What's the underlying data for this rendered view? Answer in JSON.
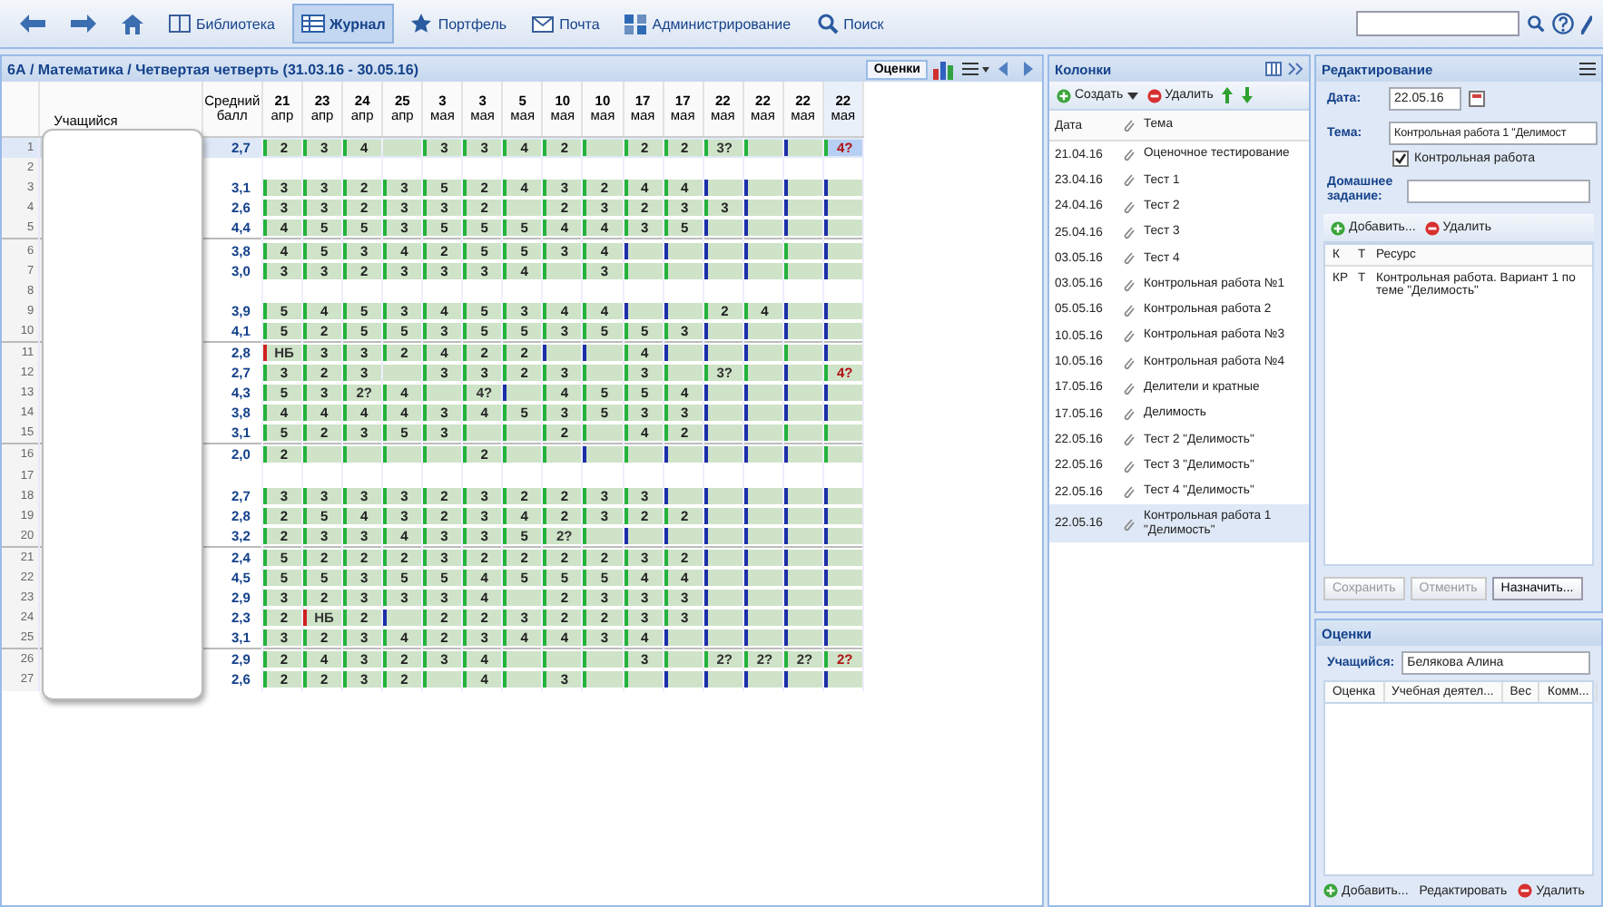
{
  "toolbar": {
    "items": [
      {
        "label": "Библиотека",
        "selected": false
      },
      {
        "label": "Журнал",
        "selected": true
      },
      {
        "label": "Портфель",
        "selected": false
      },
      {
        "label": "Почта",
        "selected": false
      },
      {
        "label": "Администрирование",
        "selected": false
      },
      {
        "label": "Поиск",
        "selected": false
      }
    ]
  },
  "journal": {
    "title": "6А / Математика / Четвертая четверть (31.03.16 - 30.05.16)",
    "tool_button": "Оценки",
    "student_heading": "Учащийся",
    "average_heading": "Средний балл",
    "columns": [
      {
        "day": "21",
        "month": "апр",
        "selected": false
      },
      {
        "day": "23",
        "month": "апр",
        "selected": false
      },
      {
        "day": "24",
        "month": "апр",
        "selected": false
      },
      {
        "day": "25",
        "month": "апр",
        "selected": false
      },
      {
        "day": "3",
        "month": "мая",
        "selected": false
      },
      {
        "day": "3",
        "month": "мая",
        "selected": false
      },
      {
        "day": "5",
        "month": "мая",
        "selected": false
      },
      {
        "day": "10",
        "month": "мая",
        "selected": false
      },
      {
        "day": "10",
        "month": "мая",
        "selected": false
      },
      {
        "day": "17",
        "month": "мая",
        "selected": false
      },
      {
        "day": "17",
        "month": "мая",
        "selected": false
      },
      {
        "day": "22",
        "month": "мая",
        "selected": false
      },
      {
        "day": "22",
        "month": "мая",
        "selected": false
      },
      {
        "day": "22",
        "month": "мая",
        "selected": false
      },
      {
        "day": "22",
        "month": "мая",
        "selected": true
      }
    ],
    "rows": [
      {
        "number": "1",
        "average": "2,7",
        "selected": true,
        "cells": [
          {
            "grade": "2",
            "color": "#22b33a"
          },
          {
            "grade": "3",
            "color": "#22b33a"
          },
          {
            "grade": "4",
            "color": "#22b33a"
          },
          null,
          {
            "grade": "3",
            "color": "#22b33a"
          },
          {
            "grade": "3",
            "color": "#22b33a"
          },
          {
            "grade": "4",
            "color": "#22b33a"
          },
          {
            "grade": "2",
            "color": "#22b33a"
          },
          {
            "color": "#22b33a"
          },
          {
            "grade": "2",
            "color": "#22b33a"
          },
          {
            "grade": "2",
            "color": "#22b33a"
          },
          {
            "grade": "3?",
            "color": "#22b33a"
          },
          {
            "color": "#22b33a"
          },
          {
            "color": "#1c2ea8"
          },
          {
            "grade": "4?",
            "color": "#22b33a"
          }
        ]
      },
      {
        "number": "2",
        "selected": false
      },
      {
        "number": "3",
        "average": "3,1",
        "selected": false,
        "cells": [
          {
            "grade": "3",
            "color": "#22b33a"
          },
          {
            "grade": "3",
            "color": "#22b33a"
          },
          {
            "grade": "2",
            "color": "#22b33a"
          },
          {
            "grade": "3",
            "color": "#22b33a"
          },
          {
            "grade": "5",
            "color": "#22b33a"
          },
          {
            "grade": "2",
            "color": "#22b33a"
          },
          {
            "grade": "4",
            "color": "#22b33a"
          },
          {
            "grade": "3",
            "color": "#22b33a"
          },
          {
            "grade": "2",
            "color": "#22b33a"
          },
          {
            "grade": "4",
            "color": "#22b33a"
          },
          {
            "grade": "4",
            "color": "#22b33a"
          },
          {
            "color": "#1c2ea8"
          },
          {
            "color": "#1c2ea8"
          },
          {
            "color": "#1c2ea8"
          },
          {
            "color": "#1c2ea8"
          }
        ]
      },
      {
        "number": "4",
        "average": "2,6",
        "selected": false,
        "cells": [
          {
            "grade": "3",
            "color": "#22b33a"
          },
          {
            "grade": "3",
            "color": "#22b33a"
          },
          {
            "grade": "2",
            "color": "#22b33a"
          },
          {
            "grade": "3",
            "color": "#22b33a"
          },
          {
            "grade": "3",
            "color": "#22b33a"
          },
          {
            "grade": "2",
            "color": "#22b33a"
          },
          {
            "color": "#22b33a"
          },
          {
            "grade": "2",
            "color": "#22b33a"
          },
          {
            "grade": "3",
            "color": "#22b33a"
          },
          {
            "grade": "2",
            "color": "#22b33a"
          },
          {
            "grade": "3",
            "color": "#22b33a"
          },
          {
            "grade": "3",
            "color": "#22b33a"
          },
          {
            "color": "#1c2ea8"
          },
          {
            "color": "#1c2ea8"
          },
          {
            "color": "#1c2ea8"
          }
        ]
      },
      {
        "number": "5",
        "average": "4,4",
        "selected": false,
        "cells": [
          {
            "grade": "4",
            "color": "#22b33a"
          },
          {
            "grade": "5",
            "color": "#22b33a"
          },
          {
            "grade": "5",
            "color": "#22b33a"
          },
          {
            "grade": "3",
            "color": "#22b33a"
          },
          {
            "grade": "5",
            "color": "#22b33a"
          },
          {
            "grade": "5",
            "color": "#22b33a"
          },
          {
            "grade": "5",
            "color": "#22b33a"
          },
          {
            "grade": "4",
            "color": "#22b33a"
          },
          {
            "grade": "4",
            "color": "#22b33a"
          },
          {
            "grade": "3",
            "color": "#22b33a"
          },
          {
            "grade": "5",
            "color": "#22b33a"
          },
          {
            "color": "#1c2ea8"
          },
          {
            "color": "#1c2ea8"
          },
          {
            "color": "#1c2ea8"
          },
          {
            "color": "#1c2ea8"
          }
        ]
      },
      {
        "number": "6",
        "average": "3,8",
        "selected": false,
        "cells": [
          {
            "grade": "4",
            "color": "#22b33a"
          },
          {
            "grade": "5",
            "color": "#22b33a"
          },
          {
            "grade": "3",
            "color": "#22b33a"
          },
          {
            "grade": "4",
            "color": "#22b33a"
          },
          {
            "grade": "2",
            "color": "#22b33a"
          },
          {
            "grade": "5",
            "color": "#22b33a"
          },
          {
            "grade": "5",
            "color": "#22b33a"
          },
          {
            "grade": "3",
            "color": "#22b33a"
          },
          {
            "grade": "4",
            "color": "#22b33a"
          },
          {
            "color": "#1c2ea8"
          },
          {
            "color": "#1c2ea8"
          },
          {
            "color": "#1c2ea8"
          },
          {
            "color": "#1c2ea8"
          },
          {
            "color": "#22b33a"
          },
          {
            "color": "#1c2ea8"
          }
        ]
      },
      {
        "number": "7",
        "average": "3,0",
        "selected": false,
        "cells": [
          {
            "grade": "3",
            "color": "#22b33a"
          },
          {
            "grade": "3",
            "color": "#22b33a"
          },
          {
            "grade": "2",
            "color": "#22b33a"
          },
          {
            "grade": "3",
            "color": "#22b33a"
          },
          {
            "grade": "3",
            "color": "#22b33a"
          },
          {
            "grade": "3",
            "color": "#22b33a"
          },
          {
            "grade": "4",
            "color": "#22b33a"
          },
          {
            "color": "#22b33a"
          },
          {
            "grade": "3",
            "color": "#22b33a"
          },
          {
            "color": "#22b33a"
          },
          {
            "color": "#22b33a"
          },
          {
            "color": "#1c2ea8"
          },
          {
            "color": "#1c2ea8"
          },
          {
            "color": "#22b33a"
          },
          {
            "color": "#1c2ea8"
          }
        ]
      },
      {
        "number": "8",
        "selected": false
      },
      {
        "number": "9",
        "average": "3,9",
        "selected": false,
        "cells": [
          {
            "grade": "5",
            "color": "#22b33a"
          },
          {
            "grade": "4",
            "color": "#22b33a"
          },
          {
            "grade": "5",
            "color": "#22b33a"
          },
          {
            "grade": "3",
            "color": "#22b33a"
          },
          {
            "grade": "4",
            "color": "#22b33a"
          },
          {
            "grade": "5",
            "color": "#22b33a"
          },
          {
            "grade": "3",
            "color": "#22b33a"
          },
          {
            "grade": "4",
            "color": "#22b33a"
          },
          {
            "grade": "4",
            "color": "#22b33a"
          },
          {
            "color": "#1c2ea8"
          },
          {
            "color": "#1c2ea8"
          },
          {
            "grade": "2",
            "color": "#22b33a"
          },
          {
            "grade": "4",
            "color": "#22b33a"
          },
          {
            "color": "#1c2ea8"
          },
          {
            "color": "#1c2ea8"
          }
        ]
      },
      {
        "number": "10",
        "average": "4,1",
        "selected": false,
        "cells": [
          {
            "grade": "5",
            "color": "#22b33a"
          },
          {
            "grade": "2",
            "color": "#22b33a"
          },
          {
            "grade": "5",
            "color": "#22b33a"
          },
          {
            "grade": "5",
            "color": "#22b33a"
          },
          {
            "grade": "3",
            "color": "#22b33a"
          },
          {
            "grade": "5",
            "color": "#22b33a"
          },
          {
            "grade": "5",
            "color": "#22b33a"
          },
          {
            "grade": "3",
            "color": "#22b33a"
          },
          {
            "grade": "5",
            "color": "#22b33a"
          },
          {
            "grade": "5",
            "color": "#22b33a"
          },
          {
            "grade": "3",
            "color": "#22b33a"
          },
          {
            "color": "#1c2ea8"
          },
          {
            "color": "#1c2ea8"
          },
          {
            "color": "#1c2ea8"
          },
          {
            "color": "#1c2ea8"
          }
        ]
      },
      {
        "number": "11",
        "average": "2,8",
        "selected": false,
        "cells": [
          {
            "grade": "НБ",
            "color": "#d02020"
          },
          {
            "grade": "3",
            "color": "#22b33a"
          },
          {
            "grade": "3",
            "color": "#22b33a"
          },
          {
            "grade": "2",
            "color": "#22b33a"
          },
          {
            "grade": "4",
            "color": "#22b33a"
          },
          {
            "grade": "2",
            "color": "#22b33a"
          },
          {
            "grade": "2",
            "color": "#22b33a"
          },
          {
            "color": "#1c2ea8"
          },
          {
            "color": "#1c2ea8"
          },
          {
            "grade": "4",
            "color": "#22b33a"
          },
          {
            "color": "#1c2ea8"
          },
          {
            "color": "#1c2ea8"
          },
          {
            "color": "#1c2ea8"
          },
          {
            "color": "#22b33a"
          },
          {
            "color": "#1c2ea8"
          }
        ]
      },
      {
        "number": "12",
        "average": "2,7",
        "selected": false,
        "cells": [
          {
            "grade": "3",
            "color": "#22b33a"
          },
          {
            "grade": "2",
            "color": "#22b33a"
          },
          {
            "grade": "3",
            "color": "#22b33a"
          },
          null,
          {
            "grade": "3",
            "color": "#22b33a"
          },
          {
            "grade": "3",
            "color": "#22b33a"
          },
          {
            "grade": "2",
            "color": "#22b33a"
          },
          {
            "grade": "3",
            "color": "#22b33a"
          },
          {
            "color": "#22b33a"
          },
          {
            "grade": "3",
            "color": "#22b33a"
          },
          {
            "color": "#22b33a"
          },
          {
            "grade": "3?",
            "color": "#22b33a"
          },
          {
            "color": "#22b33a"
          },
          {
            "color": "#1c2ea8"
          },
          {
            "grade": "4?",
            "color": "#22b33a"
          }
        ]
      },
      {
        "number": "13",
        "average": "4,3",
        "selected": false,
        "cells": [
          {
            "grade": "5",
            "color": "#22b33a"
          },
          {
            "grade": "3",
            "color": "#22b33a"
          },
          {
            "grade": "2?",
            "color": "#22b33a"
          },
          {
            "grade": "4",
            "color": "#22b33a"
          },
          {
            "color": "#22b33a"
          },
          {
            "grade": "4?",
            "color": "#22b33a"
          },
          {
            "color": "#1c2ea8"
          },
          {
            "grade": "4",
            "color": "#22b33a"
          },
          {
            "grade": "5",
            "color": "#22b33a"
          },
          {
            "grade": "5",
            "color": "#22b33a"
          },
          {
            "grade": "4",
            "color": "#22b33a"
          },
          {
            "color": "#1c2ea8"
          },
          {
            "color": "#1c2ea8"
          },
          {
            "color": "#1c2ea8"
          },
          {
            "color": "#1c2ea8"
          }
        ]
      },
      {
        "number": "14",
        "average": "3,8",
        "selected": false,
        "cells": [
          {
            "grade": "4",
            "color": "#22b33a"
          },
          {
            "grade": "4",
            "color": "#22b33a"
          },
          {
            "grade": "4",
            "color": "#22b33a"
          },
          {
            "grade": "4",
            "color": "#22b33a"
          },
          {
            "grade": "3",
            "color": "#22b33a"
          },
          {
            "grade": "4",
            "color": "#22b33a"
          },
          {
            "grade": "5",
            "color": "#22b33a"
          },
          {
            "grade": "3",
            "color": "#22b33a"
          },
          {
            "grade": "5",
            "color": "#22b33a"
          },
          {
            "grade": "3",
            "color": "#22b33a"
          },
          {
            "grade": "3",
            "color": "#22b33a"
          },
          {
            "color": "#1c2ea8"
          },
          {
            "color": "#1c2ea8"
          },
          {
            "color": "#1c2ea8"
          },
          {
            "color": "#1c2ea8"
          }
        ]
      },
      {
        "number": "15",
        "average": "3,1",
        "selected": false,
        "cells": [
          {
            "grade": "5",
            "color": "#22b33a"
          },
          {
            "grade": "2",
            "color": "#22b33a"
          },
          {
            "grade": "3",
            "color": "#22b33a"
          },
          {
            "grade": "5",
            "color": "#22b33a"
          },
          {
            "grade": "3",
            "color": "#22b33a"
          },
          {
            "color": "#22b33a"
          },
          {
            "color": "#22b33a"
          },
          {
            "grade": "2",
            "color": "#22b33a"
          },
          {
            "color": "#22b33a"
          },
          {
            "grade": "4",
            "color": "#22b33a"
          },
          {
            "grade": "2",
            "color": "#22b33a"
          },
          {
            "color": "#1c2ea8"
          },
          {
            "color": "#1c2ea8"
          },
          {
            "color": "#22b33a"
          },
          {
            "color": "#22b33a"
          }
        ]
      },
      {
        "number": "16",
        "average": "2,0",
        "selected": false,
        "cells": [
          {
            "grade": "2",
            "color": "#22b33a"
          },
          {
            "color": "#22b33a"
          },
          {
            "color": "#22b33a"
          },
          {
            "color": "#22b33a"
          },
          {
            "color": "#22b33a"
          },
          {
            "grade": "2",
            "color": "#22b33a"
          },
          {
            "color": "#22b33a"
          },
          {
            "color": "#22b33a"
          },
          {
            "color": "#1c2ea8"
          },
          {
            "color": "#22b33a"
          },
          {
            "color": "#1c2ea8"
          },
          {
            "color": "#1c2ea8"
          },
          {
            "color": "#1c2ea8"
          },
          {
            "color": "#1c2ea8"
          },
          {
            "color": "#22b33a"
          }
        ]
      },
      {
        "number": "17",
        "selected": false
      },
      {
        "number": "18",
        "average": "2,7",
        "selected": false,
        "cells": [
          {
            "grade": "3",
            "color": "#22b33a"
          },
          {
            "grade": "3",
            "color": "#22b33a"
          },
          {
            "grade": "3",
            "color": "#22b33a"
          },
          {
            "grade": "3",
            "color": "#22b33a"
          },
          {
            "grade": "2",
            "color": "#22b33a"
          },
          {
            "grade": "3",
            "color": "#22b33a"
          },
          {
            "grade": "2",
            "color": "#22b33a"
          },
          {
            "grade": "2",
            "color": "#22b33a"
          },
          {
            "grade": "3",
            "color": "#22b33a"
          },
          {
            "grade": "3",
            "color": "#22b33a"
          },
          {
            "color": "#1c2ea8"
          },
          {
            "color": "#1c2ea8"
          },
          {
            "color": "#1c2ea8"
          },
          {
            "color": "#1c2ea8"
          },
          {
            "color": "#1c2ea8"
          }
        ]
      },
      {
        "number": "19",
        "average": "2,8",
        "selected": false,
        "cells": [
          {
            "grade": "2",
            "color": "#22b33a"
          },
          {
            "grade": "5",
            "color": "#22b33a"
          },
          {
            "grade": "4",
            "color": "#22b33a"
          },
          {
            "grade": "3",
            "color": "#22b33a"
          },
          {
            "grade": "2",
            "color": "#22b33a"
          },
          {
            "grade": "3",
            "color": "#22b33a"
          },
          {
            "grade": "4",
            "color": "#22b33a"
          },
          {
            "grade": "2",
            "color": "#22b33a"
          },
          {
            "grade": "3",
            "color": "#22b33a"
          },
          {
            "grade": "2",
            "color": "#22b33a"
          },
          {
            "grade": "2",
            "color": "#22b33a"
          },
          {
            "color": "#1c2ea8"
          },
          {
            "color": "#1c2ea8"
          },
          {
            "color": "#1c2ea8"
          },
          {
            "color": "#1c2ea8"
          }
        ]
      },
      {
        "number": "20",
        "average": "3,2",
        "selected": false,
        "cells": [
          {
            "grade": "2",
            "color": "#22b33a"
          },
          {
            "grade": "3",
            "color": "#22b33a"
          },
          {
            "grade": "3",
            "color": "#22b33a"
          },
          {
            "grade": "4",
            "color": "#22b33a"
          },
          {
            "grade": "3",
            "color": "#22b33a"
          },
          {
            "grade": "3",
            "color": "#22b33a"
          },
          {
            "grade": "5",
            "color": "#22b33a"
          },
          {
            "grade": "2?",
            "color": "#22b33a"
          },
          {
            "color": "#22b33a"
          },
          {
            "color": "#1c2ea8"
          },
          {
            "color": "#1c2ea8"
          },
          {
            "color": "#1c2ea8"
          },
          {
            "color": "#1c2ea8"
          },
          {
            "color": "#1c2ea8"
          },
          {
            "color": "#1c2ea8"
          }
        ]
      },
      {
        "number": "21",
        "average": "2,4",
        "selected": false,
        "cells": [
          {
            "grade": "5",
            "color": "#22b33a"
          },
          {
            "grade": "2",
            "color": "#22b33a"
          },
          {
            "grade": "2",
            "color": "#22b33a"
          },
          {
            "grade": "2",
            "color": "#22b33a"
          },
          {
            "grade": "3",
            "color": "#22b33a"
          },
          {
            "grade": "2",
            "color": "#22b33a"
          },
          {
            "grade": "2",
            "color": "#22b33a"
          },
          {
            "grade": "2",
            "color": "#22b33a"
          },
          {
            "grade": "2",
            "color": "#22b33a"
          },
          {
            "grade": "3",
            "color": "#22b33a"
          },
          {
            "grade": "2",
            "color": "#22b33a"
          },
          {
            "color": "#1c2ea8"
          },
          {
            "color": "#1c2ea8"
          },
          {
            "color": "#1c2ea8"
          },
          {
            "color": "#1c2ea8"
          }
        ]
      },
      {
        "number": "22",
        "average": "4,5",
        "selected": false,
        "cells": [
          {
            "grade": "5",
            "color": "#22b33a"
          },
          {
            "grade": "5",
            "color": "#22b33a"
          },
          {
            "grade": "3",
            "color": "#22b33a"
          },
          {
            "grade": "5",
            "color": "#22b33a"
          },
          {
            "grade": "5",
            "color": "#22b33a"
          },
          {
            "grade": "4",
            "color": "#22b33a"
          },
          {
            "grade": "5",
            "color": "#22b33a"
          },
          {
            "grade": "5",
            "color": "#22b33a"
          },
          {
            "grade": "5",
            "color": "#22b33a"
          },
          {
            "grade": "4",
            "color": "#22b33a"
          },
          {
            "grade": "4",
            "color": "#22b33a"
          },
          {
            "color": "#1c2ea8"
          },
          {
            "color": "#1c2ea8"
          },
          {
            "color": "#1c2ea8"
          },
          {
            "color": "#1c2ea8"
          }
        ]
      },
      {
        "number": "23",
        "average": "2,9",
        "selected": false,
        "cells": [
          {
            "grade": "3",
            "color": "#22b33a"
          },
          {
            "grade": "2",
            "color": "#22b33a"
          },
          {
            "grade": "3",
            "color": "#22b33a"
          },
          {
            "grade": "3",
            "color": "#22b33a"
          },
          {
            "grade": "3",
            "color": "#22b33a"
          },
          {
            "grade": "4",
            "color": "#22b33a"
          },
          {
            "color": "#22b33a"
          },
          {
            "grade": "2",
            "color": "#22b33a"
          },
          {
            "grade": "3",
            "color": "#22b33a"
          },
          {
            "grade": "3",
            "color": "#22b33a"
          },
          {
            "grade": "3",
            "color": "#22b33a"
          },
          {
            "color": "#1c2ea8"
          },
          {
            "color": "#1c2ea8"
          },
          {
            "color": "#1c2ea8"
          },
          {
            "color": "#1c2ea8"
          }
        ]
      },
      {
        "number": "24",
        "average": "2,3",
        "selected": false,
        "cells": [
          {
            "grade": "2",
            "color": "#22b33a"
          },
          {
            "grade": "НБ",
            "color": "#d02020"
          },
          {
            "grade": "2",
            "color": "#22b33a"
          },
          {
            "color": "#1c2ea8"
          },
          {
            "grade": "2",
            "color": "#22b33a"
          },
          {
            "grade": "2",
            "color": "#22b33a"
          },
          {
            "grade": "3",
            "color": "#22b33a"
          },
          {
            "grade": "2",
            "color": "#22b33a"
          },
          {
            "grade": "2",
            "color": "#22b33a"
          },
          {
            "grade": "3",
            "color": "#22b33a"
          },
          {
            "grade": "3",
            "color": "#22b33a"
          },
          {
            "color": "#1c2ea8"
          },
          {
            "color": "#1c2ea8"
          },
          {
            "color": "#1c2ea8"
          },
          {
            "color": "#1c2ea8"
          }
        ]
      },
      {
        "number": "25",
        "average": "3,1",
        "selected": false,
        "cells": [
          {
            "grade": "3",
            "color": "#22b33a"
          },
          {
            "grade": "2",
            "color": "#22b33a"
          },
          {
            "grade": "3",
            "color": "#22b33a"
          },
          {
            "grade": "4",
            "color": "#22b33a"
          },
          {
            "grade": "2",
            "color": "#22b33a"
          },
          {
            "grade": "3",
            "color": "#22b33a"
          },
          {
            "grade": "4",
            "color": "#22b33a"
          },
          {
            "grade": "4",
            "color": "#22b33a"
          },
          {
            "grade": "3",
            "color": "#22b33a"
          },
          {
            "grade": "4",
            "color": "#22b33a"
          },
          {
            "color": "#1c2ea8"
          },
          {
            "color": "#1c2ea8"
          },
          {
            "color": "#1c2ea8"
          },
          {
            "color": "#1c2ea8"
          },
          {
            "color": "#1c2ea8"
          }
        ]
      },
      {
        "number": "26",
        "average": "2,9",
        "selected": false,
        "cells": [
          {
            "grade": "2",
            "color": "#22b33a"
          },
          {
            "grade": "4",
            "color": "#22b33a"
          },
          {
            "grade": "3",
            "color": "#22b33a"
          },
          {
            "grade": "2",
            "color": "#22b33a"
          },
          {
            "grade": "3",
            "color": "#22b33a"
          },
          {
            "grade": "4",
            "color": "#22b33a"
          },
          {
            "color": "#22b33a"
          },
          {
            "color": "#22b33a"
          },
          {
            "color": "#22b33a"
          },
          {
            "grade": "3",
            "color": "#22b33a"
          },
          {
            "color": "#22b33a"
          },
          {
            "grade": "2?",
            "color": "#22b33a"
          },
          {
            "grade": "2?",
            "color": "#22b33a"
          },
          {
            "grade": "2?",
            "color": "#22b33a"
          },
          {
            "grade": "2?",
            "color": "#22b33a"
          }
        ]
      },
      {
        "number": "27",
        "average": "2,6",
        "selected": false,
        "cells": [
          {
            "grade": "2",
            "color": "#22b33a"
          },
          {
            "grade": "2",
            "color": "#22b33a"
          },
          {
            "grade": "3",
            "color": "#22b33a"
          },
          {
            "grade": "2",
            "color": "#22b33a"
          },
          {
            "color": "#22b33a"
          },
          {
            "grade": "4",
            "color": "#22b33a"
          },
          {
            "color": "#22b33a"
          },
          {
            "grade": "3",
            "color": "#22b33a"
          },
          {
            "color": "#22b33a"
          },
          {
            "color": "#22b33a"
          },
          {
            "color": "#1c2ea8"
          },
          {
            "color": "#1c2ea8"
          },
          {
            "color": "#1c2ea8"
          },
          {
            "color": "#1c2ea8"
          },
          {
            "color": "#1c2ea8"
          }
        ]
      }
    ]
  },
  "columns_panel": {
    "title": "Колонки",
    "create_button": "Создать",
    "delete_button": "Удалить",
    "date_heading": "Дата",
    "topic_heading": "Тема",
    "items": [
      {
        "date": "21.04.16",
        "topic": "Оценочное тестирование",
        "selected": false
      },
      {
        "date": "23.04.16",
        "topic": "Тест 1",
        "selected": false
      },
      {
        "date": "24.04.16",
        "topic": "Тест 2",
        "selected": false
      },
      {
        "date": "25.04.16",
        "topic": "Тест 3",
        "selected": false
      },
      {
        "date": "03.05.16",
        "topic": "Тест 4",
        "selected": false
      },
      {
        "date": "03.05.16",
        "topic": "Контрольная работа №1",
        "selected": false
      },
      {
        "date": "05.05.16",
        "topic": "Контрольная работа 2",
        "selected": false
      },
      {
        "date": "10.05.16",
        "topic": "Контрольная работа №3",
        "selected": false
      },
      {
        "date": "10.05.16",
        "topic": "Контрольная работа №4",
        "selected": false
      },
      {
        "date": "17.05.16",
        "topic": "Делители и кратные",
        "selected": false
      },
      {
        "date": "17.05.16",
        "topic": "Делимость",
        "selected": false
      },
      {
        "date": "22.05.16",
        "topic": "Тест 2 \"Делимость\"",
        "selected": false
      },
      {
        "date": "22.05.16",
        "topic": "Тест 3 \"Делимость\"",
        "selected": false
      },
      {
        "date": "22.05.16",
        "topic": "Тест 4 \"Делимость\"",
        "selected": false
      },
      {
        "date": "22.05.16",
        "topic": "Контрольная работа 1 \"Делимость\"",
        "selected": true
      }
    ]
  },
  "edit_panel": {
    "title": "Редактирование",
    "date_label": "Дата:",
    "date_value": "22.05.16",
    "topic_label": "Тема:",
    "topic_value": "Контрольная работа 1 \"Делимост",
    "checkbox": {
      "label": "Контрольная работа",
      "checked": true
    },
    "homework_label": "Домашнее задание:",
    "add_button": "Добавить...",
    "delete_button": "Удалить",
    "resource_headings": [
      "К",
      "Т",
      "Ресурс"
    ],
    "resources": [
      {
        "code": "КР",
        "type": "Т",
        "title": "Контрольная работа. Вариант 1 по теме \"Делимость\""
      }
    ],
    "buttons": [
      {
        "label": "Сохранить",
        "disabled": true
      },
      {
        "label": "Отменить",
        "disabled": true
      },
      {
        "label": "Назначить...",
        "disabled": false
      }
    ]
  },
  "marks_panel": {
    "title": "Оценки",
    "student_label": "Учащийся:",
    "student_value": "Белякова Алина",
    "headings": [
      "Оценка",
      "Учебная деятел...",
      "Вес",
      "Комм..."
    ],
    "buttons": [
      "Добавить...",
      "Редактировать",
      "Удалить"
    ]
  }
}
